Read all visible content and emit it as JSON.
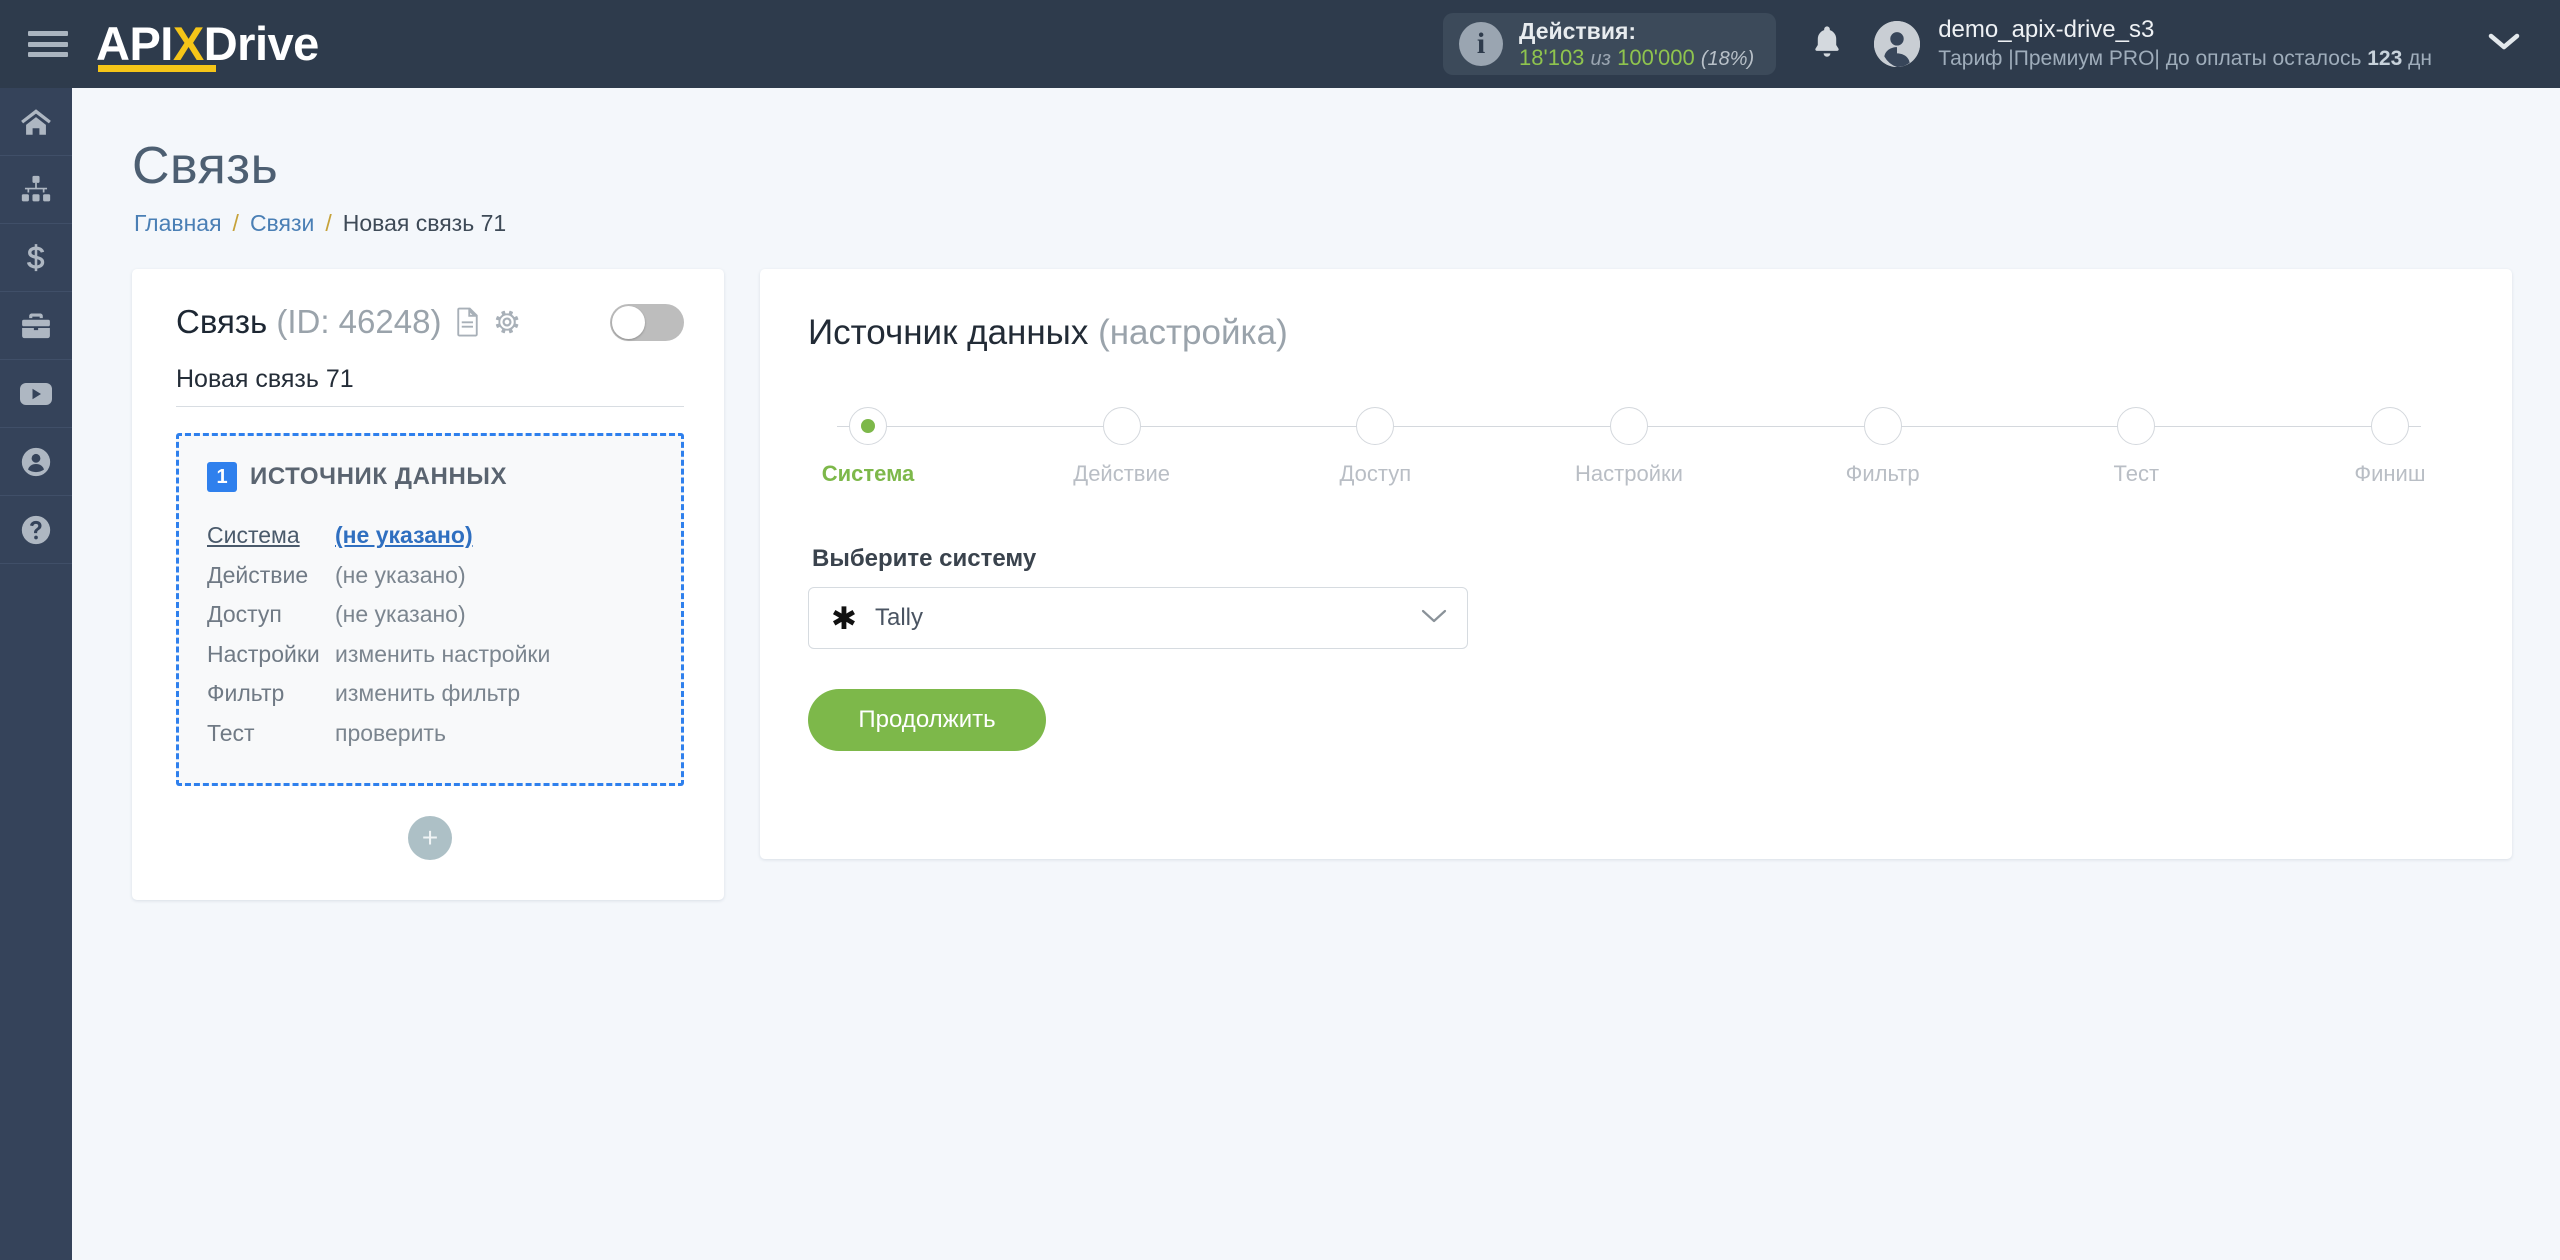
{
  "brand": {
    "name_api": "API",
    "name_x": "X",
    "name_drive": "Drive"
  },
  "topbar": {
    "actions_label": "Действия:",
    "actions_used": "18'103",
    "actions_of": "из",
    "actions_total": "100'000",
    "actions_percent": "(18%)",
    "user_name": "demo_apix-drive_s3",
    "tariff_prefix": "Тариф |",
    "tariff_name": "Премиум PRO",
    "tariff_suffix": "| до оплаты осталось",
    "tariff_days": "123",
    "tariff_days_unit": "дн"
  },
  "rail": [
    {
      "name": "home-icon"
    },
    {
      "name": "connections-icon"
    },
    {
      "name": "billing-icon"
    },
    {
      "name": "briefcase-icon"
    },
    {
      "name": "youtube-icon"
    },
    {
      "name": "account-icon"
    },
    {
      "name": "help-icon"
    }
  ],
  "page": {
    "title": "Связь",
    "breadcrumb": {
      "home": "Главная",
      "list": "Связи",
      "current": "Новая связь 71",
      "sep": "/"
    }
  },
  "connection": {
    "title": "Связь",
    "id_text": "(ID: 46248)",
    "name": "Новая связь 71",
    "toggle_on": false
  },
  "source_block": {
    "step_number": "1",
    "title": "ИСТОЧНИК ДАННЫХ",
    "rows": [
      {
        "key": "Система",
        "value": "(не указано)",
        "active": true
      },
      {
        "key": "Действие",
        "value": "(не указано)",
        "active": false
      },
      {
        "key": "Доступ",
        "value": "(не указано)",
        "active": false
      },
      {
        "key": "Настройки",
        "value": "изменить настройки",
        "active": false
      },
      {
        "key": "Фильтр",
        "value": "изменить фильтр",
        "active": false
      },
      {
        "key": "Тест",
        "value": "проверить",
        "active": false
      }
    ],
    "add_label": "+"
  },
  "panel": {
    "title": "Источник данных",
    "title_muted": "(настройка)",
    "steps": [
      {
        "label": "Система",
        "done": true
      },
      {
        "label": "Действие",
        "done": false
      },
      {
        "label": "Доступ",
        "done": false
      },
      {
        "label": "Настройки",
        "done": false
      },
      {
        "label": "Фильтр",
        "done": false
      },
      {
        "label": "Тест",
        "done": false
      },
      {
        "label": "Финиш",
        "done": false
      }
    ],
    "select_label": "Выберите систему",
    "select_icon": "✱",
    "select_value": "Tally",
    "submit_label": "Продолжить"
  },
  "colors": {
    "topbar": "#2e3b4c",
    "rail": "#35435a",
    "accent_yellow": "#f5c518",
    "accent_green": "#7db84a",
    "accent_blue": "#2f80ed",
    "page_bg": "#f4f7fb"
  }
}
